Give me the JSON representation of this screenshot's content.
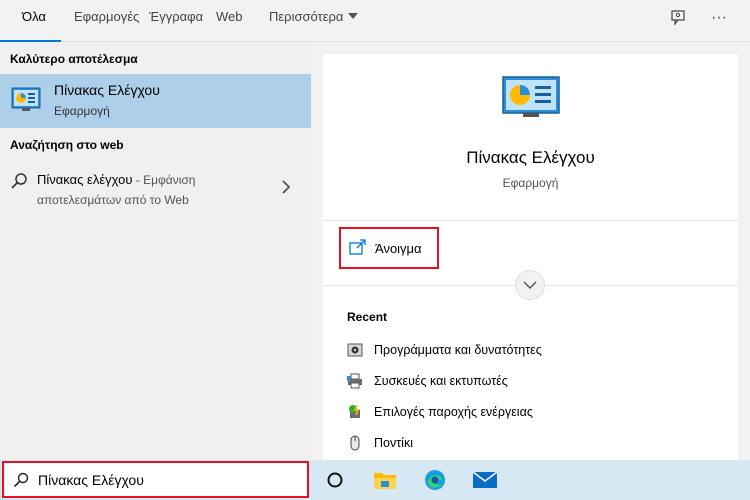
{
  "tabs": [
    {
      "label": "Όλα",
      "active": true
    },
    {
      "label": "Εφαρμογές"
    },
    {
      "label": "Έγγραφα"
    },
    {
      "label": "Web"
    },
    {
      "label": "Περισσότερα"
    }
  ],
  "top_icons": [
    "feedback-icon",
    "more-options-icon"
  ],
  "top_more_glyph": "···",
  "left": {
    "best_label": "Καλύτερο αποτέλεσμα",
    "best": {
      "title": "Πίνακας Ελέγχου",
      "subtitle": "Εφαρμογή",
      "icon": "control-panel-icon"
    },
    "web_label": "Αναζήτηση στο web",
    "web_item": {
      "query": "Πίνακας ελέγχου",
      "suffix": " - Εμφάνιση",
      "line2": "αποτελεσμάτων από το Web"
    }
  },
  "right": {
    "title": "Πίνακας Ελέγχου",
    "type": "Εφαρμογή",
    "open_label": "Άνοιγμα",
    "recent_label": "Recent",
    "recent": [
      {
        "label": "Προγράμματα και δυνατότητες",
        "icon": "programs-icon"
      },
      {
        "label": "Συσκευές και εκτυπωτές",
        "icon": "printer-icon"
      },
      {
        "label": "Επιλογές παροχής ενέργειας",
        "icon": "power-icon"
      },
      {
        "label": "Ποντίκι",
        "icon": "mouse-icon"
      }
    ]
  },
  "taskbar": {
    "search_value": "Πίνακας Ελέγχου",
    "items": [
      "cortana-icon",
      "file-explorer-icon",
      "edge-icon",
      "mail-icon"
    ]
  },
  "colors": {
    "accent": "#0078d7",
    "highlight": "#adcfe9",
    "annotation": "#e81123",
    "taskbar": "#d5e8f3"
  }
}
